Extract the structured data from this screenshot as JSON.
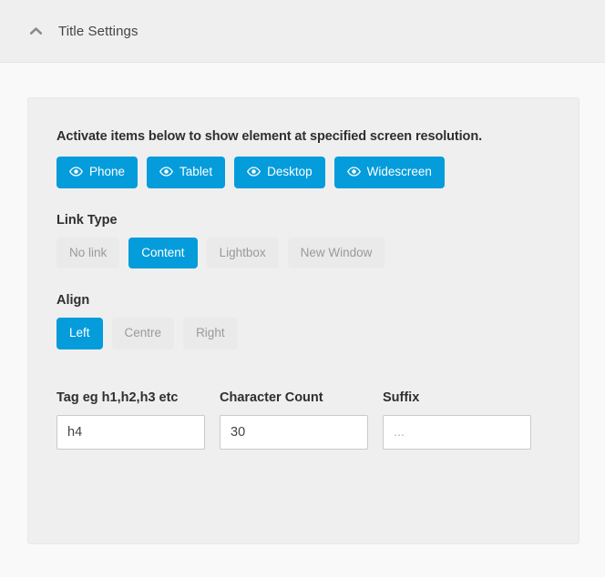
{
  "header": {
    "title": "Title Settings",
    "collapse_icon": "chevron-up-icon"
  },
  "card": {
    "help_text": "Activate items below to show element at specified screen resolution.",
    "resolution_buttons": [
      {
        "label": "Phone",
        "icon": "eye-icon",
        "active": true
      },
      {
        "label": "Tablet",
        "icon": "eye-icon",
        "active": true
      },
      {
        "label": "Desktop",
        "icon": "eye-icon",
        "active": true
      },
      {
        "label": "Widescreen",
        "icon": "eye-icon",
        "active": true
      }
    ],
    "link_type": {
      "label": "Link Type",
      "options": [
        {
          "label": "No link",
          "active": false
        },
        {
          "label": "Content",
          "active": true
        },
        {
          "label": "Lightbox",
          "active": false
        },
        {
          "label": "New Window",
          "active": false
        }
      ]
    },
    "align": {
      "label": "Align",
      "options": [
        {
          "label": "Left",
          "active": true
        },
        {
          "label": "Centre",
          "active": false
        },
        {
          "label": "Right",
          "active": false
        }
      ]
    },
    "fields": [
      {
        "label": "Tag eg h1,h2,h3 etc",
        "value": "h4",
        "placeholder": ""
      },
      {
        "label": "Character Count",
        "value": "30",
        "placeholder": ""
      },
      {
        "label": "Suffix",
        "value": "",
        "placeholder": "..."
      }
    ]
  },
  "colors": {
    "accent": "#049cdb",
    "header_bg": "#efefef",
    "body_bg": "#f9f9f9",
    "card_bg": "#efefef",
    "inactive_bg": "#eaeaea",
    "inactive_text": "#9a9a9a"
  }
}
